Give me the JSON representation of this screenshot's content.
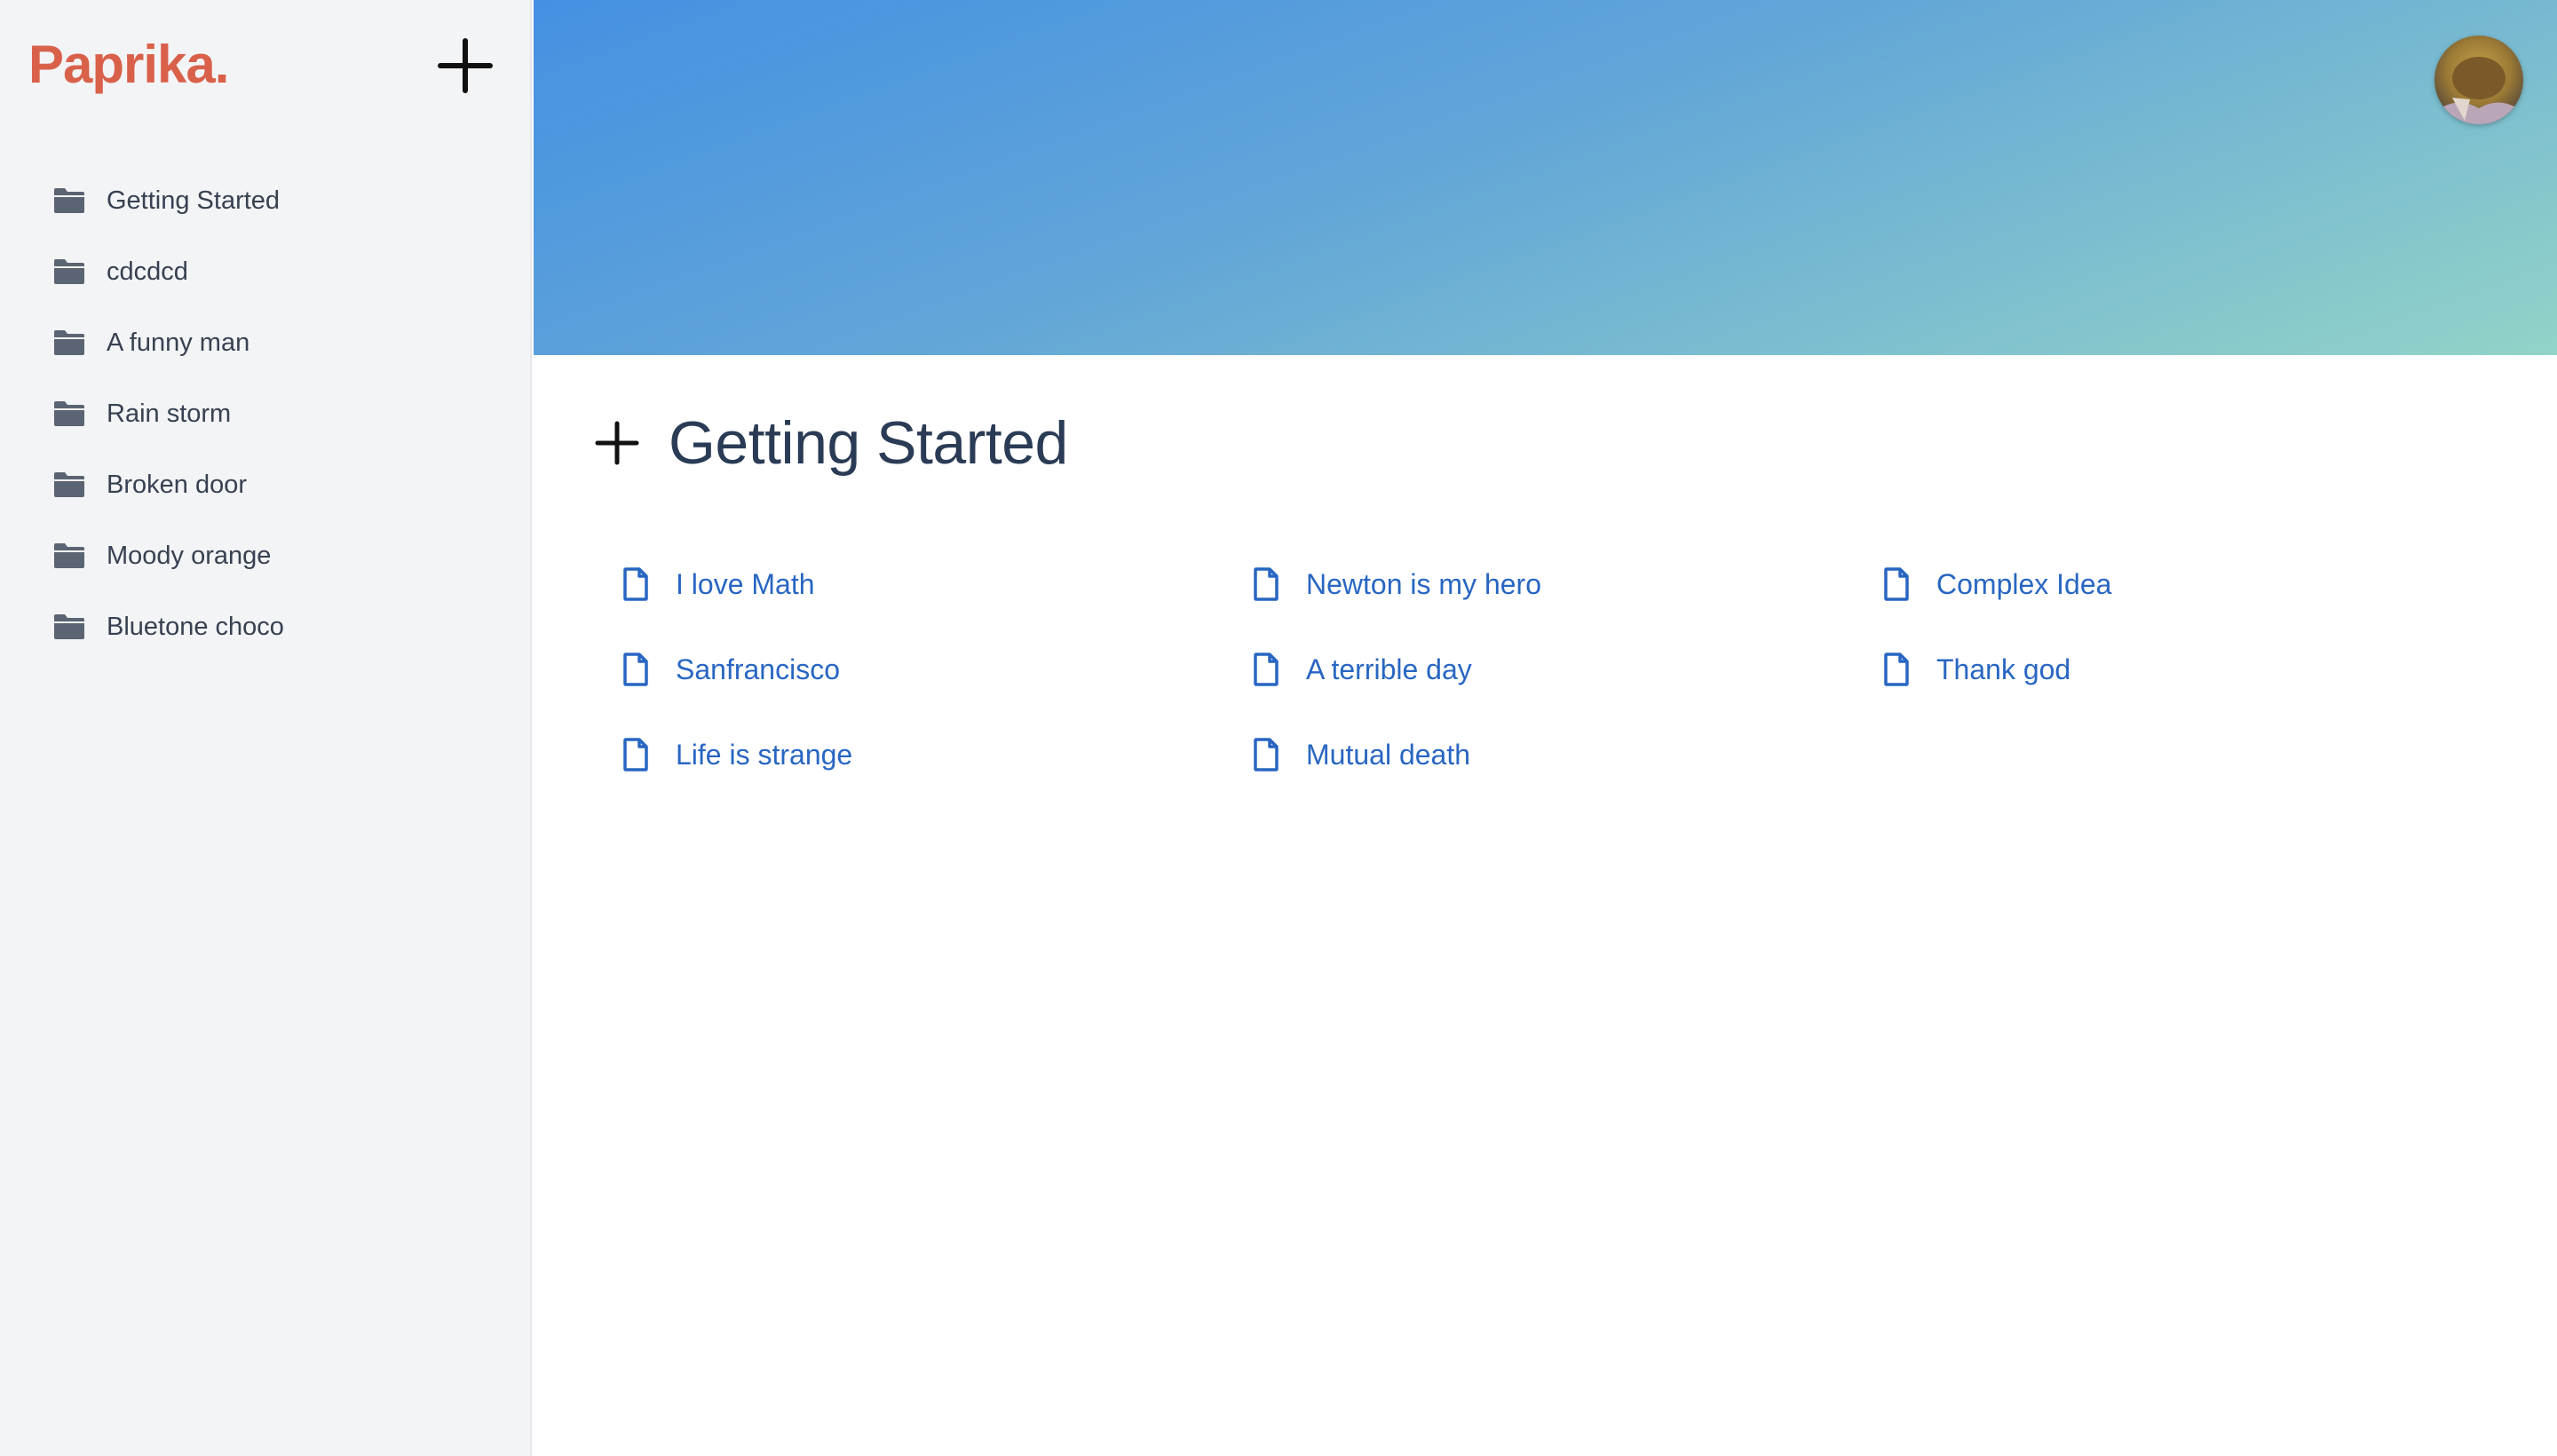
{
  "brand": {
    "name": "Paprika."
  },
  "sidebar": {
    "folders": [
      {
        "label": "Getting Started",
        "icon": "folder-icon"
      },
      {
        "label": "cdcdcd",
        "icon": "folder-icon"
      },
      {
        "label": "A funny man",
        "icon": "folder-icon"
      },
      {
        "label": "Rain storm",
        "icon": "folder-icon"
      },
      {
        "label": "Broken door",
        "icon": "folder-icon"
      },
      {
        "label": "Moody orange",
        "icon": "folder-icon"
      },
      {
        "label": "Bluetone choco",
        "icon": "folder-icon"
      }
    ]
  },
  "main": {
    "title": "Getting Started",
    "notes": [
      {
        "label": "I love Math",
        "icon": "document-icon"
      },
      {
        "label": "Newton is my hero",
        "icon": "document-icon"
      },
      {
        "label": "Complex Idea",
        "icon": "document-icon"
      },
      {
        "label": "Sanfrancisco",
        "icon": "document-icon"
      },
      {
        "label": "A terrible day",
        "icon": "document-icon"
      },
      {
        "label": "Thank god",
        "icon": "document-icon"
      },
      {
        "label": "Life is strange",
        "icon": "document-icon"
      },
      {
        "label": "Mutual death",
        "icon": "document-icon"
      }
    ]
  },
  "colors": {
    "brand": "#d9614a",
    "link": "#2866c2",
    "sidebar_bg": "#f3f4f6",
    "banner_start": "#4590e2",
    "banner_end": "#93d3c8"
  }
}
